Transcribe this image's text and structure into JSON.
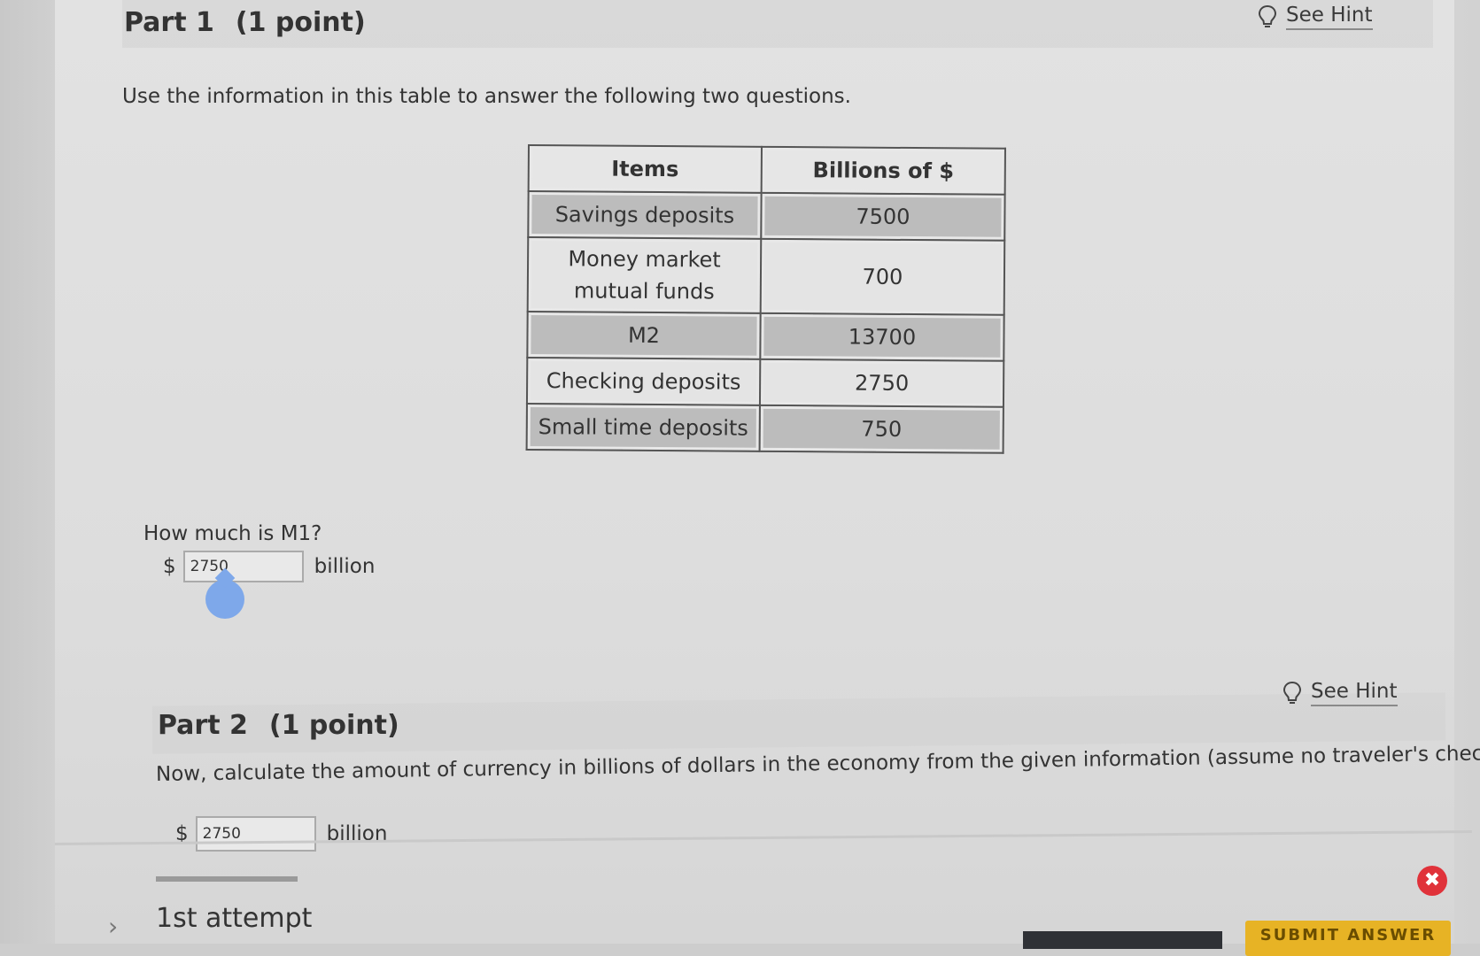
{
  "part1": {
    "title": "Part 1",
    "points": "(1 point)",
    "hint_label": "See Hint",
    "intro": "Use the information in this table to answer the following two questions.",
    "question": "How much is M1?",
    "currency_symbol": "$",
    "answer_value": "2750",
    "unit": "billion"
  },
  "table": {
    "headers": [
      "Items",
      "Billions of $"
    ],
    "rows": [
      {
        "item": "Savings deposits",
        "value": "7500"
      },
      {
        "item_line1": "Money market",
        "item_line2": "mutual funds",
        "value": "700"
      },
      {
        "item": "M2",
        "value": "13700"
      },
      {
        "item": "Checking deposits",
        "value": "2750"
      },
      {
        "item": "Small time deposits",
        "value": "750"
      }
    ]
  },
  "part2": {
    "title": "Part 2",
    "points": "(1 point)",
    "hint_label": "See Hint",
    "question": "Now, calculate the amount of currency in billions of dollars in the economy from the given information (assume no traveler's checks).",
    "currency_symbol": "$",
    "answer_value": "2750",
    "unit": "billion"
  },
  "attempt": {
    "label": "1st attempt",
    "submit_label": "SUBMIT ANSWER"
  }
}
